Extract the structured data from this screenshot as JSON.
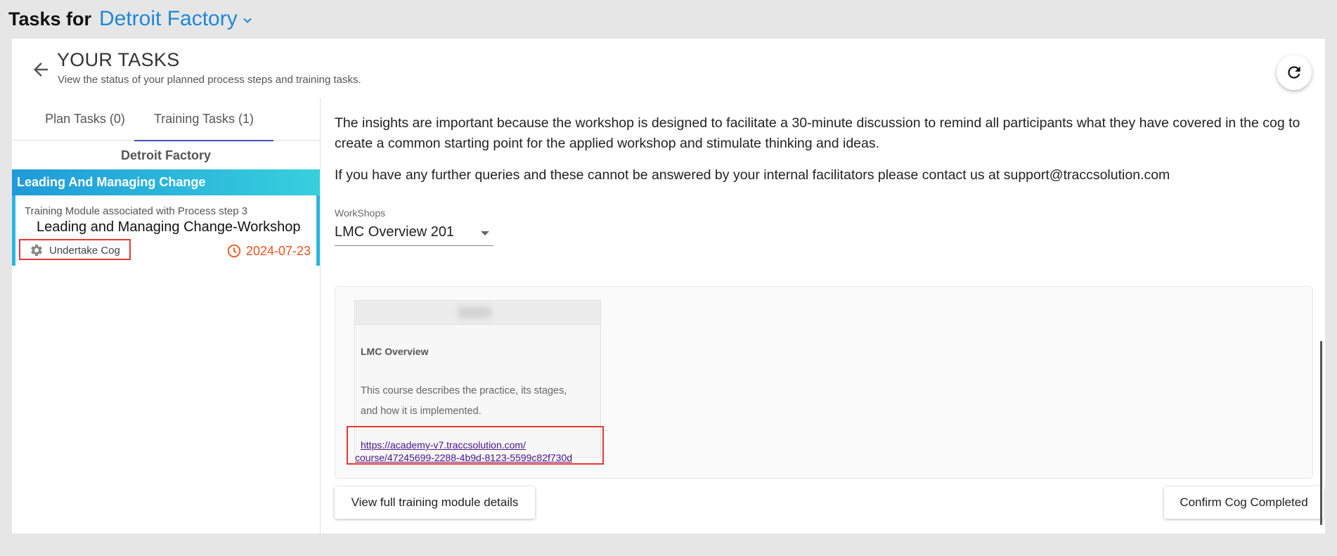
{
  "topbar": {
    "tasks_for_label": "Tasks for",
    "site_name": "Detroit Factory"
  },
  "header": {
    "title": "YOUR TASKS",
    "subtitle": "View the status of your planned process steps and training tasks."
  },
  "left": {
    "tabs": [
      {
        "label": "Plan Tasks (0)",
        "active": false
      },
      {
        "label": "Training Tasks (1)",
        "active": true
      }
    ],
    "group_name": "Detroit Factory",
    "group_header": "Leading And Managing Change",
    "task": {
      "subtitle": "Training Module associated with Process step 3",
      "name": "Leading and Managing Change-Workshop",
      "action_label": "Undertake Cog",
      "due_date": "2024-07-23"
    }
  },
  "content": {
    "clipped_line": "... ...",
    "paragraph_1": "The insights are important because the workshop is designed to facilitate a 30-minute discussion to remind all participants what they have covered in the cog to create a common starting point for the applied workshop and stimulate thinking and ideas.",
    "paragraph_2": "If you have any further queries and these cannot be answered by your internal facilitators please contact us at support@traccsolution.com",
    "workshops_label": "WorkShops",
    "workshop_selected": "LMC Overview 201",
    "course": {
      "title": "LMC Overview",
      "description": "This course describes the practice, its stages, and how it is implemented.",
      "link_line1": "https://academy-v7.traccsolution.com/",
      "link_line2": "course/47245699-2288-4b9d-8123-5599c82f730d"
    },
    "view_button": "View full training module details",
    "confirm_button": "Confirm Cog Completed"
  },
  "colors": {
    "accent_blue": "#1e88d6",
    "tab_indicator": "#3f51b5",
    "group_gradient_start": "#1f9ad8",
    "group_gradient_end": "#37d0de",
    "due_date": "#f4511e",
    "highlight_box": "#e53935",
    "link": "#4a148c"
  },
  "icons": {
    "site_dropdown": "chevron-down-icon",
    "back": "arrow-left-icon",
    "refresh": "refresh-icon",
    "undertake": "gear-icon",
    "due": "clock-icon"
  }
}
